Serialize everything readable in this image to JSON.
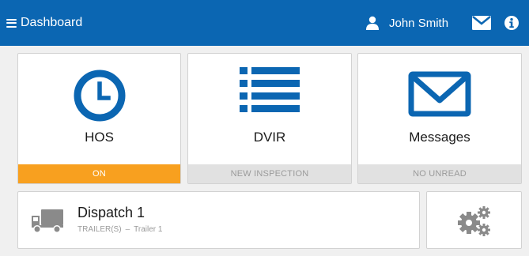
{
  "header": {
    "title": "Dashboard",
    "user_name": "John Smith",
    "background": "#0b66b2"
  },
  "tiles": [
    {
      "label": "HOS",
      "status": "ON",
      "icon": "clock-icon",
      "status_color": "#f8a01f"
    },
    {
      "label": "DVIR",
      "status": "NEW INSPECTION",
      "icon": "list-icon"
    },
    {
      "label": "Messages",
      "status": "NO UNREAD",
      "icon": "envelope-icon"
    }
  ],
  "dispatch": {
    "title": "Dispatch 1",
    "trailer_prefix": "TRAILER(S)",
    "separator": "–",
    "trailer": "Trailer 1",
    "icon": "truck-icon"
  },
  "settings": {
    "icon": "gears-icon"
  },
  "colors": {
    "accent": "#0b66b2",
    "status_on": "#f8a01f",
    "status_off": "#e1e1e1"
  }
}
